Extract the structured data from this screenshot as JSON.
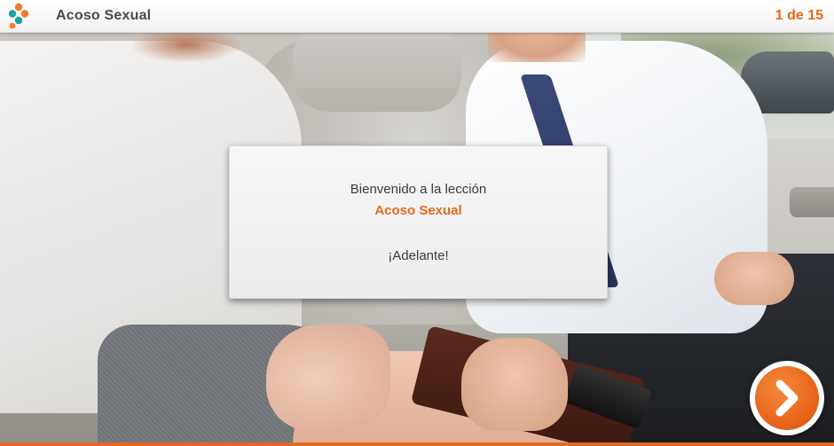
{
  "header": {
    "course_title": "Acoso Sexual",
    "page_counter": "1 de 15",
    "logo_icon": "four-dots-logo-icon"
  },
  "dialog": {
    "welcome_text": "Bienvenido a la lección",
    "lesson_name": "Acoso Sexual",
    "forward_text": "¡Adelante!"
  },
  "navigation": {
    "next_icon": "chevron-right-icon"
  },
  "colors": {
    "accent": "#e36a1c",
    "logo_orange": "#f07c2b",
    "logo_teal": "#1aa5a0",
    "text_dark": "#4a4a4a"
  }
}
